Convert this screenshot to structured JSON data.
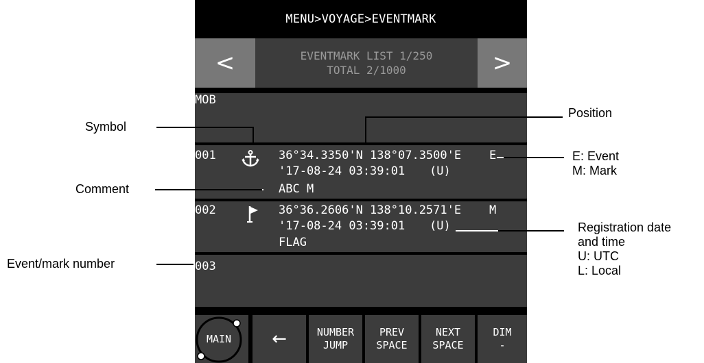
{
  "header": {
    "breadcrumb": "MENU>VOYAGE>EVENTMARK"
  },
  "nav": {
    "prev_label": "<",
    "next_label": ">"
  },
  "list_header": {
    "line1": "EVENTMARK LIST 1/250",
    "line2": "TOTAL 2/1000"
  },
  "mob_row": {
    "label": "MOB"
  },
  "entries": [
    {
      "number": "001",
      "symbol": "anchor-icon",
      "position": "36°34.3350'N 138°07.3500'E",
      "type": "E",
      "datetime": "'17-08-24 03:39:01",
      "time_zone": "(U)",
      "comment": "ABC M"
    },
    {
      "number": "002",
      "symbol": "flag-icon",
      "position": "36°36.2606'N 138°10.2571'E",
      "type": "M",
      "datetime": "'17-08-24 03:39:01",
      "time_zone": "(U)",
      "comment": "FLAG"
    },
    {
      "number": "003"
    }
  ],
  "footer": {
    "main": "MAIN",
    "back": "←",
    "number_jump": [
      "NUMBER",
      "JUMP"
    ],
    "prev_space": [
      "PREV",
      "SPACE"
    ],
    "next_space": [
      "NEXT",
      "SPACE"
    ],
    "dim": [
      "DIM",
      "-"
    ]
  },
  "callouts": {
    "symbol": "Symbol",
    "position": "Position",
    "event_mark": [
      "E: Event",
      "M: Mark"
    ],
    "comment": "Comment",
    "registration": [
      "Registration date",
      "and time",
      "U: UTC",
      "L: Local"
    ],
    "number": "Event/mark number"
  },
  "colors": {
    "panel": "#000000",
    "row": "#3c3c3c",
    "nav_button": "#787878",
    "header_text": "#9a9a9a"
  }
}
